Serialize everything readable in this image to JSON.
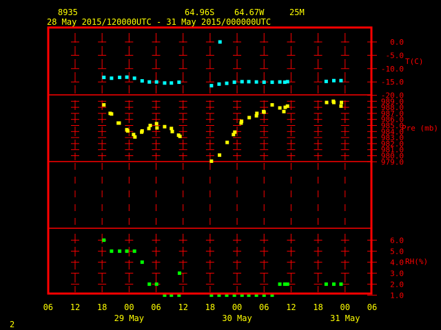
{
  "header": {
    "station": "8935",
    "lat": "64.96S",
    "lon": "64.67W",
    "elev": "25M",
    "period": "28 May 2015/120000UTC - 31 May 2015/000000UTC"
  },
  "footer_label": "2",
  "colors": {
    "frame": "#ff0000",
    "text": "#ffff00",
    "temp": "#00ffff",
    "pressure": "#ffff00",
    "rh": "#00ff00"
  },
  "chart_data": {
    "type": "scatter",
    "x_unit": "hours since 28 May 2015 06 UTC",
    "xlim": [
      0,
      72
    ],
    "x_ticks": [
      {
        "h": 0,
        "label": "06"
      },
      {
        "h": 6,
        "label": "12"
      },
      {
        "h": 12,
        "label": "18"
      },
      {
        "h": 18,
        "label": "00"
      },
      {
        "h": 24,
        "label": "06"
      },
      {
        "h": 30,
        "label": "12"
      },
      {
        "h": 36,
        "label": "18"
      },
      {
        "h": 42,
        "label": "00"
      },
      {
        "h": 48,
        "label": "06"
      },
      {
        "h": 54,
        "label": "12"
      },
      {
        "h": 60,
        "label": "18"
      },
      {
        "h": 66,
        "label": "00"
      },
      {
        "h": 72,
        "label": "06"
      }
    ],
    "date_labels": [
      {
        "h": 18,
        "label": "29 May"
      },
      {
        "h": 42,
        "label": "30 May"
      },
      {
        "h": 66,
        "label": "31 May"
      }
    ],
    "panels": [
      {
        "name": "temperature",
        "ylabel": "T(C)",
        "ylim": [
          -20,
          0
        ],
        "y_ticks": [
          "0.0",
          "-5.0",
          "-10.0",
          "-15.0",
          "-20.0"
        ],
        "y_tick_values": [
          0,
          -5,
          -10,
          -15,
          -20
        ],
        "points": [
          [
            12.4,
            -13.3
          ],
          [
            14.1,
            -13.6
          ],
          [
            15.9,
            -13.3
          ],
          [
            17.5,
            -13.2
          ],
          [
            19.2,
            -13.6
          ],
          [
            20.9,
            -14.6
          ],
          [
            22.5,
            -15.0
          ],
          [
            24.1,
            -15.0
          ],
          [
            25.9,
            -15.4
          ],
          [
            27.4,
            -15.4
          ],
          [
            29.1,
            -15.1
          ],
          [
            36.3,
            -16.4
          ],
          [
            38.0,
            -15.8
          ],
          [
            38.2,
            0.0
          ],
          [
            39.7,
            -15.5
          ],
          [
            41.4,
            -15.1
          ],
          [
            43.1,
            -14.9
          ],
          [
            44.6,
            -14.9
          ],
          [
            46.3,
            -15.0
          ],
          [
            48.0,
            -15.1
          ],
          [
            49.8,
            -15.1
          ],
          [
            51.5,
            -15.0
          ],
          [
            52.6,
            -15.1
          ],
          [
            53.2,
            -14.9
          ],
          [
            61.8,
            -14.8
          ],
          [
            63.5,
            -14.5
          ],
          [
            65.1,
            -14.5
          ]
        ]
      },
      {
        "name": "pressure",
        "ylabel": "Pre (mb)",
        "ylim": [
          979,
          989
        ],
        "y_ticks": [
          "989.0",
          "988.0",
          "987.0",
          "986.0",
          "985.0",
          "984.0",
          "983.0",
          "982.0",
          "981.0",
          "980.0",
          "979.0"
        ],
        "y_tick_values": [
          989,
          988,
          987,
          986,
          985,
          984,
          983,
          982,
          981,
          980,
          979
        ],
        "points": [
          [
            12.4,
            988.4
          ],
          [
            13.8,
            987.0
          ],
          [
            14.1,
            986.9
          ],
          [
            15.6,
            985.4
          ],
          [
            15.8,
            985.4
          ],
          [
            17.5,
            984.3
          ],
          [
            17.7,
            984.1
          ],
          [
            19.0,
            983.5
          ],
          [
            19.3,
            983.1
          ],
          [
            20.8,
            983.9
          ],
          [
            20.9,
            984.1
          ],
          [
            22.4,
            984.5
          ],
          [
            22.7,
            985.0
          ],
          [
            24.1,
            985.3
          ],
          [
            24.2,
            984.6
          ],
          [
            25.9,
            984.8
          ],
          [
            27.4,
            984.5
          ],
          [
            27.6,
            984.0
          ],
          [
            29.0,
            983.4
          ],
          [
            29.3,
            983.2
          ],
          [
            36.3,
            979.1
          ],
          [
            38.1,
            980.1
          ],
          [
            39.8,
            982.2
          ],
          [
            41.2,
            983.5
          ],
          [
            41.5,
            983.9
          ],
          [
            42.9,
            985.4
          ],
          [
            43.0,
            985.7
          ],
          [
            44.7,
            986.3
          ],
          [
            46.3,
            986.6
          ],
          [
            46.4,
            987.0
          ],
          [
            47.9,
            987.3
          ],
          [
            48.0,
            987.2
          ],
          [
            49.8,
            988.4
          ],
          [
            51.5,
            987.9
          ],
          [
            52.4,
            987.3
          ],
          [
            52.7,
            988.0
          ],
          [
            53.2,
            988.2
          ],
          [
            61.9,
            988.8
          ],
          [
            63.4,
            989.0
          ],
          [
            63.5,
            988.8
          ],
          [
            65.1,
            988.2
          ],
          [
            65.2,
            988.8
          ]
        ]
      },
      {
        "name": "relative-humidity",
        "ylabel": "RH(%)",
        "ylim": [
          1,
          6
        ],
        "y_ticks": [
          "6.0",
          "5.0",
          "4.0",
          "3.0",
          "2.0",
          "1.0"
        ],
        "y_tick_values": [
          6,
          5,
          4,
          3,
          2,
          1
        ],
        "points": [
          [
            12.4,
            6
          ],
          [
            14.1,
            5
          ],
          [
            15.9,
            5
          ],
          [
            17.5,
            5
          ],
          [
            19.2,
            5
          ],
          [
            20.9,
            4
          ],
          [
            22.5,
            2
          ],
          [
            24.1,
            2
          ],
          [
            25.9,
            1
          ],
          [
            27.4,
            1
          ],
          [
            29.1,
            1
          ],
          [
            29.2,
            3
          ],
          [
            36.3,
            1
          ],
          [
            38.0,
            1
          ],
          [
            39.7,
            1
          ],
          [
            41.4,
            1
          ],
          [
            43.1,
            1
          ],
          [
            44.6,
            1
          ],
          [
            46.3,
            1
          ],
          [
            48.0,
            1
          ],
          [
            49.8,
            1
          ],
          [
            51.5,
            2
          ],
          [
            52.6,
            2
          ],
          [
            53.2,
            2
          ],
          [
            61.8,
            2
          ],
          [
            63.5,
            2
          ],
          [
            65.1,
            2
          ]
        ]
      }
    ]
  }
}
